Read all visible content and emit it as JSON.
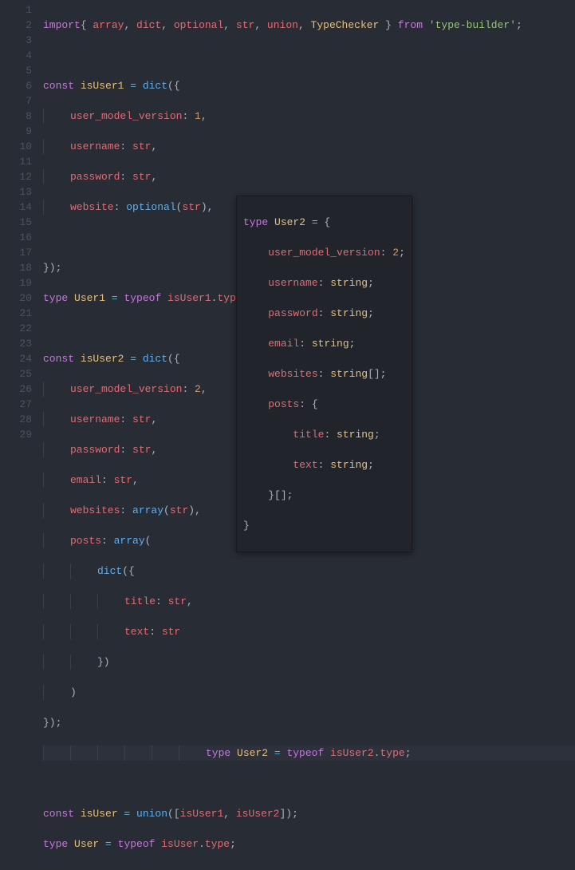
{
  "lineNumbers": [
    "1",
    "2",
    "3",
    "4",
    "5",
    "6",
    "7",
    "8",
    "9",
    "10",
    "11",
    "12",
    "13",
    "14",
    "15",
    "16",
    "17",
    "18",
    "19",
    "20",
    "21",
    "22",
    "23",
    "24",
    "25",
    "26",
    "27",
    "28",
    "29"
  ],
  "code": {
    "l1": {
      "import": "import",
      "ob": "{ ",
      "a": "array",
      "c0": ", ",
      "d": "dict",
      "c1": ", ",
      "o": "optional",
      "c2": ", ",
      "s": "str",
      "c3": ", ",
      "u": "union",
      "c4": ", ",
      "t": "TypeChecker",
      "cb": " }",
      "from": " from ",
      "mod": "'type-builder'",
      "semi": ";"
    },
    "l3": {
      "const": "const ",
      "name": "isUser1",
      "eq": " = ",
      "fn": "dict",
      "open": "({"
    },
    "l4": {
      "ind": "    ",
      "prop": "user_model_version",
      "col": ": ",
      "val": "1",
      "comma": ","
    },
    "l5": {
      "ind": "    ",
      "prop": "username",
      "col": ": ",
      "val": "str",
      "comma": ","
    },
    "l6": {
      "ind": "    ",
      "prop": "password",
      "col": ": ",
      "val": "str",
      "comma": ","
    },
    "l7": {
      "ind": "    ",
      "prop": "website",
      "col": ": ",
      "fn": "optional",
      "open": "(",
      "val": "str",
      "close": ")",
      "comma": ","
    },
    "l9": {
      "close": "});"
    },
    "l10": {
      "type": "type ",
      "name": "User1",
      "eq": " = ",
      "typeof": "typeof ",
      "var": "isUser1",
      "dot": ".",
      "prop": "type",
      "semi": ";"
    },
    "l12": {
      "const": "const ",
      "name": "isUser2",
      "eq": " = ",
      "fn": "dict",
      "open": "({"
    },
    "l13": {
      "ind": "    ",
      "prop": "user_model_version",
      "col": ": ",
      "val": "2",
      "comma": ","
    },
    "l14": {
      "ind": "    ",
      "prop": "username",
      "col": ": ",
      "val": "str",
      "comma": ","
    },
    "l15": {
      "ind": "    ",
      "prop": "password",
      "col": ": ",
      "val": "str",
      "comma": ","
    },
    "l16": {
      "ind": "    ",
      "prop": "email",
      "col": ": ",
      "val": "str",
      "comma": ","
    },
    "l17": {
      "ind": "    ",
      "prop": "websites",
      "col": ": ",
      "fn": "array",
      "open": "(",
      "val": "str",
      "close": ")",
      "comma": ","
    },
    "l18": {
      "ind": "    ",
      "prop": "posts",
      "col": ": ",
      "fn": "array",
      "open": "("
    },
    "l19": {
      "ind": "        ",
      "fn": "dict",
      "open": "({"
    },
    "l20": {
      "ind": "            ",
      "prop": "title",
      "col": ": ",
      "val": "str",
      "comma": ","
    },
    "l21": {
      "ind": "            ",
      "prop": "text",
      "col": ": ",
      "val": "str"
    },
    "l22": {
      "ind": "        ",
      "close": "})"
    },
    "l23": {
      "ind": "    ",
      "close": ")"
    },
    "l24": {
      "close": "});"
    },
    "l25": {
      "ind": "                        ",
      "type": "type ",
      "name": "User2",
      "eq": " = ",
      "typeof": "typeof ",
      "var": "isUser2",
      "dot": ".",
      "prop": "type",
      "semi": ";"
    },
    "l27": {
      "const": "const ",
      "name": "isUser",
      "eq": " = ",
      "fn": "union",
      "open": "([",
      "v1": "isUser1",
      "c": ", ",
      "v2": "isUser2",
      "close": "]);"
    },
    "l28": {
      "type": "type ",
      "name": "User",
      "eq": " = ",
      "typeof": "typeof ",
      "var": "isUser",
      "dot": ".",
      "prop": "type",
      "semi": ";"
    }
  },
  "tooltip": {
    "l1": {
      "type": "type ",
      "name": "User2",
      "eq": " = {"
    },
    "l2": {
      "ind": "    ",
      "prop": "user_model_version",
      "col": ": ",
      "val": "2",
      "semi": ";"
    },
    "l3": {
      "ind": "    ",
      "prop": "username",
      "col": ": ",
      "val": "string",
      "semi": ";"
    },
    "l4": {
      "ind": "    ",
      "prop": "password",
      "col": ": ",
      "val": "string",
      "semi": ";"
    },
    "l5": {
      "ind": "    ",
      "prop": "email",
      "col": ": ",
      "val": "string",
      "semi": ";"
    },
    "l6": {
      "ind": "    ",
      "prop": "websites",
      "col": ": ",
      "val": "string",
      "arr": "[]",
      "semi": ";"
    },
    "l7": {
      "ind": "    ",
      "prop": "posts",
      "col": ": {"
    },
    "l8": {
      "ind": "        ",
      "prop": "title",
      "col": ": ",
      "val": "string",
      "semi": ";"
    },
    "l9": {
      "ind": "        ",
      "prop": "text",
      "col": ": ",
      "val": "string",
      "semi": ";"
    },
    "l10": {
      "ind": "    ",
      "close": "}[];"
    },
    "l11": {
      "close": "}"
    }
  }
}
